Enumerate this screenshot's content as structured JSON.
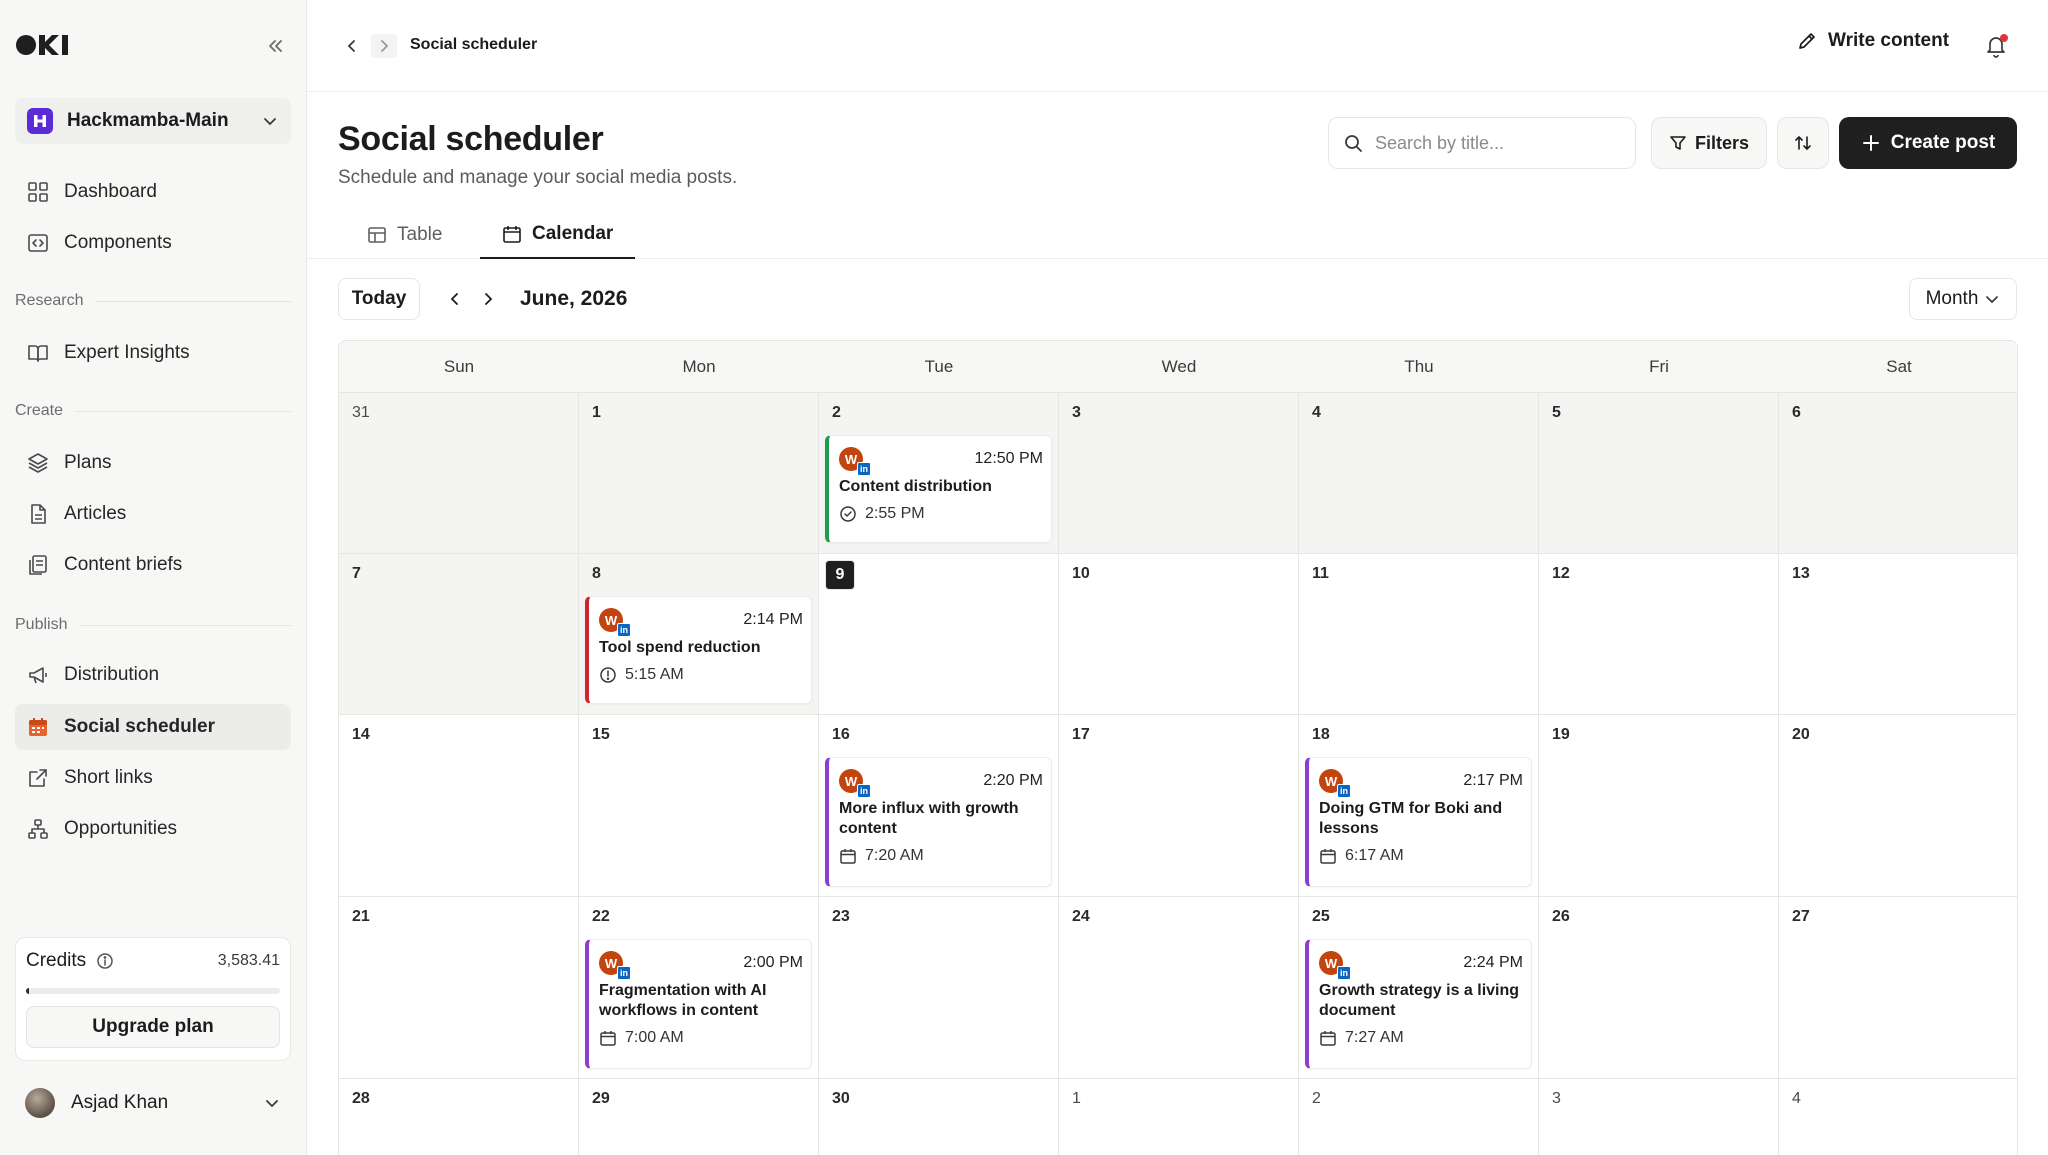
{
  "sidebar": {
    "workspace": "Hackmamba-Main",
    "items": [
      {
        "label": "Dashboard",
        "icon": "grid-icon"
      },
      {
        "label": "Components",
        "icon": "code-square-icon"
      }
    ],
    "research_label": "Research",
    "research_items": [
      {
        "label": "Expert Insights",
        "icon": "book-open-icon"
      }
    ],
    "create_label": "Create",
    "create_items": [
      {
        "label": "Plans",
        "icon": "layers-icon"
      },
      {
        "label": "Articles",
        "icon": "file-icon"
      },
      {
        "label": "Content briefs",
        "icon": "files-icon"
      }
    ],
    "publish_label": "Publish",
    "publish_items": [
      {
        "label": "Distribution",
        "icon": "megaphone-icon"
      },
      {
        "label": "Social scheduler",
        "icon": "calendar-icon",
        "active": true
      },
      {
        "label": "Short links",
        "icon": "external-link-icon"
      },
      {
        "label": "Opportunities",
        "icon": "network-icon"
      }
    ],
    "credits": {
      "label": "Credits",
      "value": "3,583.41",
      "usage_fraction": 0.01,
      "upgrade_label": "Upgrade plan"
    },
    "user": {
      "name": "Asjad Khan"
    }
  },
  "topbar": {
    "breadcrumb": "Social scheduler",
    "write_label": "Write content"
  },
  "header": {
    "title": "Social scheduler",
    "subtitle": "Schedule and manage your social media posts.",
    "search_placeholder": "Search by title...",
    "filters_label": "Filters",
    "create_label": "Create post"
  },
  "tabs": [
    {
      "label": "Table",
      "icon": "table-icon",
      "active": false
    },
    {
      "label": "Calendar",
      "icon": "calendar-icon",
      "active": true
    }
  ],
  "calendar": {
    "today_label": "Today",
    "month_label": "June, 2026",
    "view_label": "Month",
    "weekdays": [
      "Sun",
      "Mon",
      "Tue",
      "Wed",
      "Thu",
      "Fri",
      "Sat"
    ],
    "weeks": [
      [
        "31",
        "1",
        "2",
        "3",
        "4",
        "5",
        "6"
      ],
      [
        "7",
        "8",
        "9",
        "10",
        "11",
        "12",
        "13"
      ],
      [
        "14",
        "15",
        "16",
        "17",
        "18",
        "19",
        "20"
      ],
      [
        "21",
        "22",
        "23",
        "24",
        "25",
        "26",
        "27"
      ],
      [
        "28",
        "29",
        "30",
        "1",
        "2",
        "3",
        "4"
      ]
    ],
    "today_day": "9",
    "events": [
      {
        "week": 0,
        "day": 2,
        "time": "12:50 PM",
        "title": "Content distribution",
        "sub": "2:55 PM",
        "sub_icon": "check-circle-icon",
        "color": "#1a9e4b"
      },
      {
        "week": 1,
        "day": 1,
        "time": "2:14 PM",
        "title": "Tool spend reduction",
        "sub": "5:15 AM",
        "sub_icon": "alert-circle-icon",
        "color": "#d0242b"
      },
      {
        "week": 2,
        "day": 2,
        "time": "2:20 PM",
        "title": "More influx with growth content",
        "sub": "7:20 AM",
        "sub_icon": "calendar-icon",
        "color": "#8b3fd1"
      },
      {
        "week": 2,
        "day": 4,
        "time": "2:17 PM",
        "title": "Doing GTM for Boki and lessons",
        "sub": "6:17 AM",
        "sub_icon": "calendar-icon",
        "color": "#8b3fd1"
      },
      {
        "week": 3,
        "day": 1,
        "time": "2:00 PM",
        "title": "Fragmentation with AI workflows in content",
        "sub": "7:00 AM",
        "sub_icon": "calendar-icon",
        "color": "#8b3fd1"
      },
      {
        "week": 3,
        "day": 4,
        "time": "2:24 PM",
        "title": "Growth strategy is a living document",
        "sub": "7:27 AM",
        "sub_icon": "calendar-icon",
        "color": "#8b3fd1"
      }
    ],
    "avatar_letter": "W",
    "network_badge": "in"
  }
}
